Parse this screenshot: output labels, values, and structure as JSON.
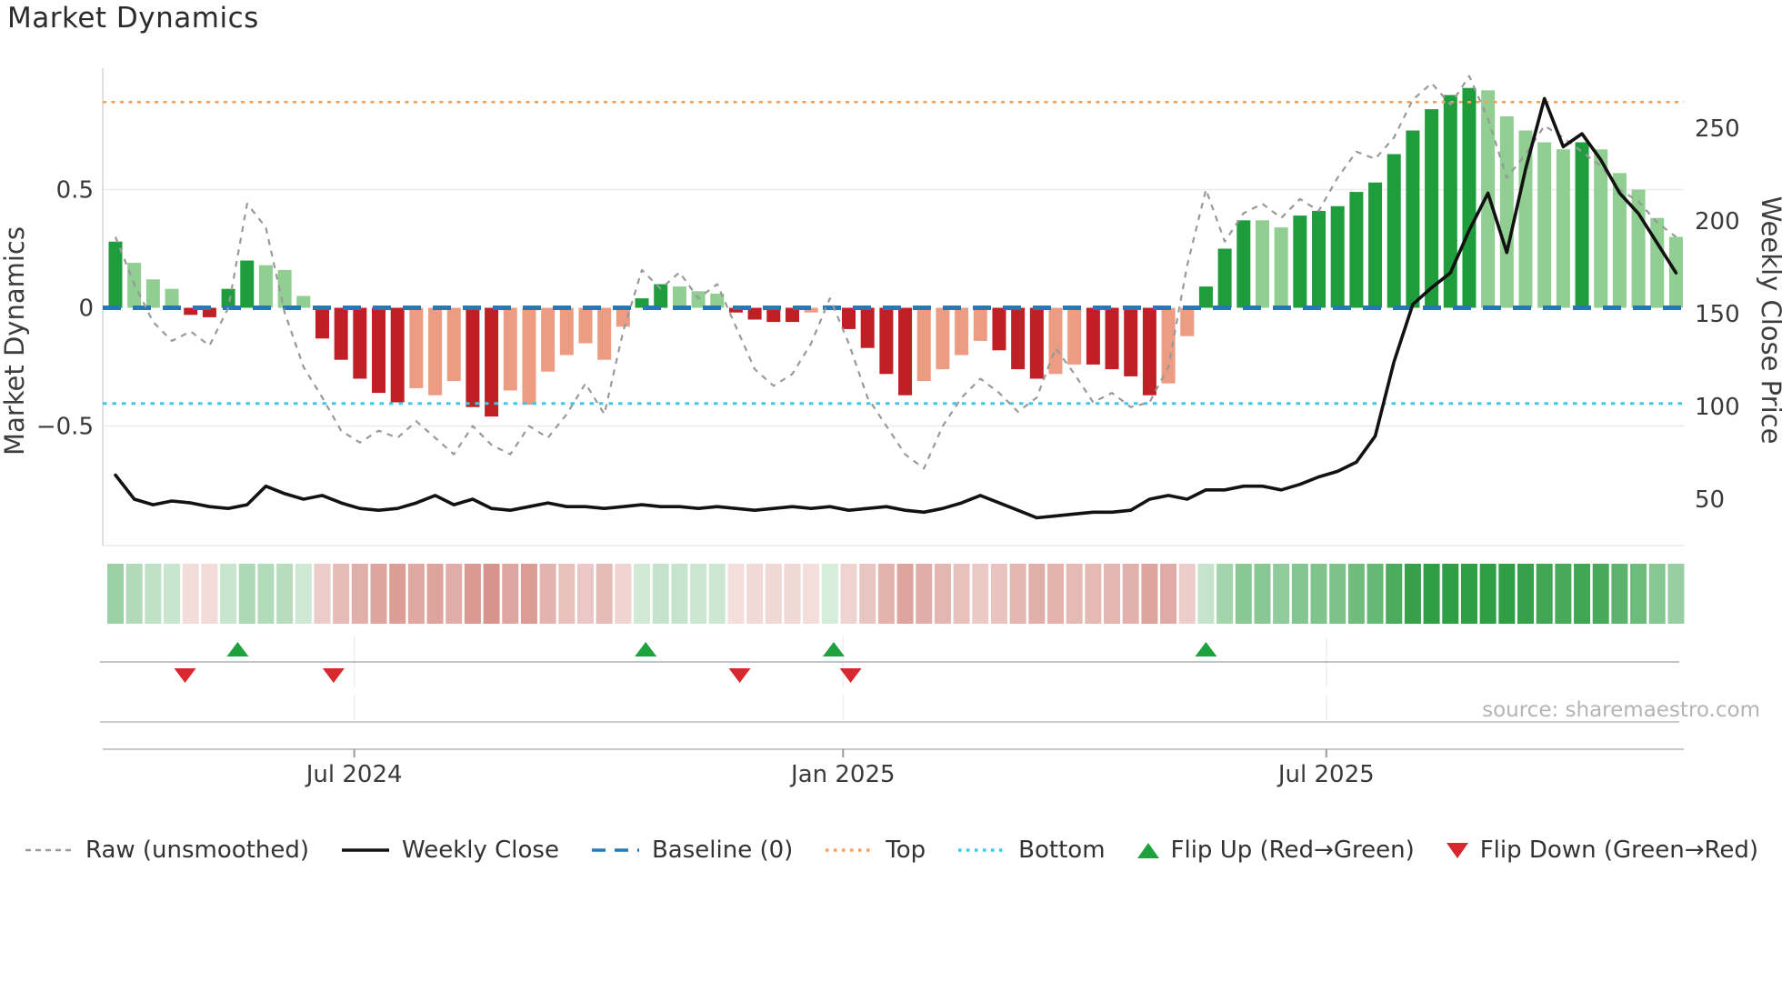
{
  "title": "Market Dynamics",
  "source_note": "source: sharemaestro.com",
  "axes": {
    "left_title": "Market Dynamics",
    "right_title": "Weekly Close Price",
    "left_ticks": [
      {
        "label": "0.5",
        "value": 0.5
      },
      {
        "label": "0",
        "value": 0
      },
      {
        "label": "−0.5",
        "value": -0.5
      }
    ],
    "right_ticks": [
      {
        "label": "250",
        "value": 250
      },
      {
        "label": "200",
        "value": 200
      },
      {
        "label": "150",
        "value": 150
      },
      {
        "label": "100",
        "value": 100
      },
      {
        "label": "50",
        "value": 50
      }
    ],
    "x_ticks": [
      {
        "label": "Jul 2024",
        "week": 12.7
      },
      {
        "label": "Jan 2025",
        "week": 38.7
      },
      {
        "label": "Jul 2025",
        "week": 64.4
      }
    ]
  },
  "colors": {
    "bar_up_strong": "#1f9d3d",
    "bar_up_soft": "#90ce92",
    "bar_down_strong": "#c01f26",
    "bar_down_soft": "#ec9c82",
    "baseline": "#2878b4",
    "top_line": "#f2a25e",
    "bottom_line": "#3ec9e9",
    "raw_line": "#999999",
    "price_line": "#121212",
    "flip_up": "#1da23e",
    "flip_down": "#d7282f",
    "heat_green": "#2f9e44",
    "heat_red": "#c35d52",
    "grid": "#ebebf0",
    "spine": "#d5d5d8",
    "row_line": "#c3c3c3",
    "tick_text": "#3a3a3a"
  },
  "legend": {
    "items": [
      {
        "id": "raw",
        "label": "Raw (unsmoothed)",
        "swatch": "dashed-line",
        "color": "#999999"
      },
      {
        "id": "weekly-close",
        "label": "Weekly Close",
        "swatch": "solid-line",
        "color": "#121212"
      },
      {
        "id": "baseline",
        "label": "Baseline (0)",
        "swatch": "long-dashes",
        "color": "#2878b4"
      },
      {
        "id": "top",
        "label": "Top",
        "swatch": "dots",
        "color": "#f2a25e"
      },
      {
        "id": "bottom",
        "label": "Bottom",
        "swatch": "dots",
        "color": "#3ec9e9"
      },
      {
        "id": "flip-up",
        "label": "Flip Up (Red→Green)",
        "swatch": "triangle-up",
        "color": "#1da23e"
      },
      {
        "id": "flip-down",
        "label": "Flip Down (Green→Red)",
        "swatch": "triangle-down",
        "color": "#d7282f"
      }
    ]
  },
  "chart_data": {
    "type": "combo",
    "title": "Market Dynamics",
    "ylabel_left": "Market Dynamics",
    "ylabel_right": "Weekly Close Price",
    "left_ylim": [
      -0.72,
      1.05
    ],
    "right_ylim": [
      30,
      285
    ],
    "n_weeks": 84,
    "x_tick_labels": [
      "Jul 2024",
      "Jan 2025",
      "Jul 2025"
    ],
    "x_tick_weeks": [
      12.7,
      38.7,
      64.4
    ],
    "reference_lines": {
      "baseline": 0,
      "top": 0.87,
      "bottom": -0.405
    },
    "series": [
      {
        "name": "Momentum bars",
        "type": "bar",
        "axis": "left",
        "values": [
          0.28,
          0.19,
          0.12,
          0.08,
          -0.03,
          -0.04,
          0.08,
          0.2,
          0.18,
          0.16,
          0.05,
          -0.13,
          -0.22,
          -0.3,
          -0.36,
          -0.4,
          -0.34,
          -0.37,
          -0.31,
          -0.42,
          -0.46,
          -0.35,
          -0.41,
          -0.27,
          -0.2,
          -0.15,
          -0.22,
          -0.08,
          0.04,
          0.1,
          0.09,
          0.07,
          0.06,
          -0.02,
          -0.05,
          -0.06,
          -0.06,
          -0.02,
          0.01,
          -0.09,
          -0.17,
          -0.28,
          -0.37,
          -0.31,
          -0.26,
          -0.2,
          -0.14,
          -0.18,
          -0.26,
          -0.3,
          -0.28,
          -0.24,
          -0.24,
          -0.26,
          -0.29,
          -0.37,
          -0.32,
          -0.12,
          0.09,
          0.25,
          0.37,
          0.37,
          0.34,
          0.39,
          0.41,
          0.43,
          0.49,
          0.53,
          0.65,
          0.75,
          0.84,
          0.9,
          0.93,
          0.92,
          0.81,
          0.75,
          0.7,
          0.67,
          0.7,
          0.67,
          0.57,
          0.5,
          0.38,
          0.3
        ],
        "shades": [
          "s",
          "m",
          "m",
          "m",
          "s",
          "s",
          "s",
          "s",
          "m",
          "m",
          "m",
          "s",
          "s",
          "s",
          "s",
          "s",
          "m",
          "m",
          "m",
          "s",
          "s",
          "m",
          "m",
          "m",
          "m",
          "m",
          "m",
          "m",
          "s",
          "s",
          "m",
          "m",
          "m",
          "s",
          "s",
          "s",
          "s",
          "m",
          "s",
          "s",
          "s",
          "s",
          "s",
          "m",
          "m",
          "m",
          "m",
          "s",
          "s",
          "s",
          "m",
          "m",
          "s",
          "s",
          "s",
          "s",
          "m",
          "m",
          "s",
          "s",
          "s",
          "m",
          "m",
          "s",
          "s",
          "s",
          "s",
          "s",
          "s",
          "s",
          "s",
          "s",
          "s",
          "m",
          "m",
          "m",
          "m",
          "m",
          "s",
          "m",
          "m",
          "m",
          "m",
          "m"
        ]
      },
      {
        "name": "Raw (unsmoothed)",
        "type": "line",
        "axis": "left",
        "values": [
          0.3,
          0.1,
          -0.06,
          -0.14,
          -0.1,
          -0.16,
          0.0,
          0.44,
          0.34,
          -0.02,
          -0.25,
          -0.38,
          -0.52,
          -0.57,
          -0.52,
          -0.55,
          -0.48,
          -0.55,
          -0.62,
          -0.5,
          -0.58,
          -0.62,
          -0.5,
          -0.55,
          -0.45,
          -0.32,
          -0.45,
          -0.1,
          0.16,
          0.08,
          0.15,
          0.04,
          0.1,
          -0.08,
          -0.26,
          -0.33,
          -0.28,
          -0.15,
          0.04,
          -0.15,
          -0.38,
          -0.5,
          -0.62,
          -0.68,
          -0.5,
          -0.38,
          -0.3,
          -0.36,
          -0.44,
          -0.38,
          -0.17,
          -0.28,
          -0.4,
          -0.36,
          -0.42,
          -0.4,
          -0.25,
          0.18,
          0.5,
          0.28,
          0.4,
          0.44,
          0.38,
          0.46,
          0.41,
          0.55,
          0.66,
          0.63,
          0.72,
          0.88,
          0.95,
          0.86,
          0.98,
          0.8,
          0.55,
          0.65,
          0.77,
          0.72,
          0.66,
          0.6,
          0.5,
          0.45,
          0.36,
          0.3
        ]
      },
      {
        "name": "Weekly Close",
        "type": "line",
        "axis": "right",
        "values": [
          63,
          50,
          47,
          49,
          48,
          46,
          45,
          47,
          57,
          53,
          50,
          52,
          48,
          45,
          44,
          45,
          48,
          52,
          47,
          50,
          45,
          44,
          46,
          48,
          46,
          46,
          45,
          46,
          47,
          46,
          46,
          45,
          46,
          45,
          44,
          45,
          46,
          45,
          46,
          44,
          45,
          46,
          44,
          43,
          45,
          48,
          52,
          48,
          44,
          40,
          41,
          42,
          43,
          43,
          44,
          50,
          52,
          50,
          55,
          55,
          57,
          57,
          55,
          58,
          62,
          65,
          70,
          84,
          124,
          155,
          164,
          172,
          195,
          215,
          183,
          228,
          266,
          240,
          247,
          233,
          215,
          204,
          188,
          172
        ]
      }
    ],
    "heatmap": {
      "description": "one cell per week, color intensity follows bar magnitude, green positive / red negative",
      "source_series": "Momentum bars"
    },
    "flip_up_weeks": [
      6.5,
      28.2,
      38.2,
      58.0
    ],
    "flip_down_weeks": [
      3.7,
      11.6,
      33.2,
      39.1
    ],
    "legend_entries": [
      "Raw (unsmoothed)",
      "Weekly Close",
      "Baseline (0)",
      "Top",
      "Bottom",
      "Flip Up (Red→Green)",
      "Flip Down (Green→Red)"
    ],
    "legend_position": "bottom"
  }
}
